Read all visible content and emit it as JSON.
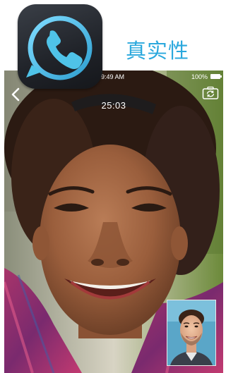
{
  "promo": {
    "feature_title": "真实性",
    "app_icon": "phone-ring-icon"
  },
  "status_bar": {
    "time": "9:49 AM",
    "battery": "100%"
  },
  "call": {
    "duration": "25:03"
  },
  "icons": {
    "back": "chevron-left-icon",
    "switch_camera": "camera-switch-icon"
  },
  "colors": {
    "title_accent": "#2aa8dd",
    "icon_ring": "#4fc3e8",
    "icon_background": "#23262c"
  }
}
